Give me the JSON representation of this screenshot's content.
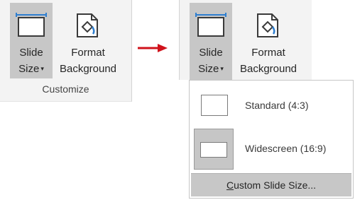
{
  "left_ribbon": {
    "slide_size": {
      "line1": "Slide",
      "line2": "Size",
      "caret": "▾",
      "icon": "slide-size-icon"
    },
    "format_background": {
      "line1": "Format",
      "line2": "Background",
      "icon": "format-background-icon"
    },
    "group_label": "Customize"
  },
  "right_ribbon": {
    "slide_size": {
      "line1": "Slide",
      "line2": "Size",
      "caret": "▾",
      "icon": "slide-size-icon"
    },
    "format_background": {
      "line1": "Format",
      "line2": "Background",
      "icon": "format-background-icon"
    }
  },
  "transition_arrow": {
    "icon": "right-arrow-icon",
    "color": "#d0121b"
  },
  "dropdown": {
    "items": [
      {
        "label": "Standard (4:3)",
        "selected": false
      },
      {
        "label": "Widescreen (16:9)",
        "selected": true
      }
    ],
    "custom": {
      "mnemonic": "C",
      "rest": "ustom Slide Size..."
    }
  },
  "colors": {
    "ribbon_bg": "#f3f3f3",
    "active_bg": "#c7c7c7",
    "accent_blue": "#2f7fd0"
  }
}
